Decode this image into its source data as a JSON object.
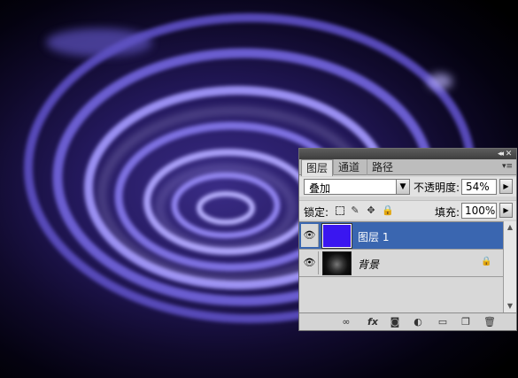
{
  "titlebar": {
    "collapse_icon": "◂◂",
    "close_icon": "✕"
  },
  "tabs": [
    {
      "label": "图层",
      "active": true
    },
    {
      "label": "通道",
      "active": false
    },
    {
      "label": "路径",
      "active": false
    }
  ],
  "panel_menu_icon": "▾≡",
  "blend": {
    "mode": "叠加",
    "arrow": "▼"
  },
  "opacity": {
    "label": "不透明度:",
    "value": "54%",
    "arrow": "▶"
  },
  "lock": {
    "label": "锁定:",
    "brush_icon": "✎",
    "move_icon": "✥",
    "all_icon": "🔒"
  },
  "fill": {
    "label": "填充:",
    "value": "100%",
    "arrow": "▶"
  },
  "layers": [
    {
      "name": "图层 1",
      "visible": true,
      "selected": true,
      "eye_icon": "👁",
      "thumb_color": "#3a16f0"
    },
    {
      "name": "背景",
      "visible": true,
      "selected": false,
      "eye_icon": "👁",
      "lock_icon": "🔒"
    }
  ],
  "scroll": {
    "up": "▲",
    "down": "▼"
  },
  "footer": {
    "link_icon": "∞",
    "fx_label": "fx",
    "mask_icon": "◙",
    "adjust_icon": "◐",
    "group_icon": "▭",
    "new_icon": "❐",
    "delete_icon": "🗑"
  },
  "colors": {
    "selection": "#3a66b0",
    "panel_bg": "#d4d4d4",
    "artwork_purple": "#4a3aa8"
  }
}
